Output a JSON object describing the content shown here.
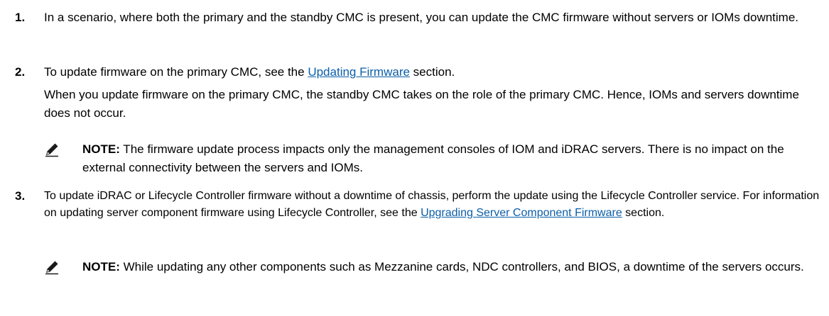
{
  "steps": [
    {
      "number": "1.",
      "text": "In a scenario, where both the primary and the standby CMC is present, you can update the CMC firmware without servers or IOMs downtime."
    },
    {
      "number": "2.",
      "text_before_link": "To update firmware on the primary CMC, see the ",
      "link": "Updating Firmware",
      "text_after_link": " section.",
      "detail": "When you update firmware on the primary CMC, the standby CMC takes on the role of the primary CMC. Hence, IOMs and servers downtime does not occur.",
      "note": {
        "label": "NOTE:",
        "text": " The firmware update process impacts only the management consoles of IOM and iDRAC servers. There is no impact on the external connectivity between the servers and IOMs."
      }
    },
    {
      "number": "3.",
      "text_before_link": "To update iDRAC or Lifecycle Controller firmware without a downtime of chassis, perform the update using the Lifecycle Controller service. For information on updating server component firmware using Lifecycle Controller, see the ",
      "link": "Upgrading Server Component Firmware",
      "text_after_link": " section.",
      "note": {
        "label": "NOTE:",
        "text": " While updating any other components such as Mezzanine cards, NDC controllers, and BIOS, a downtime of the servers occurs."
      }
    }
  ]
}
